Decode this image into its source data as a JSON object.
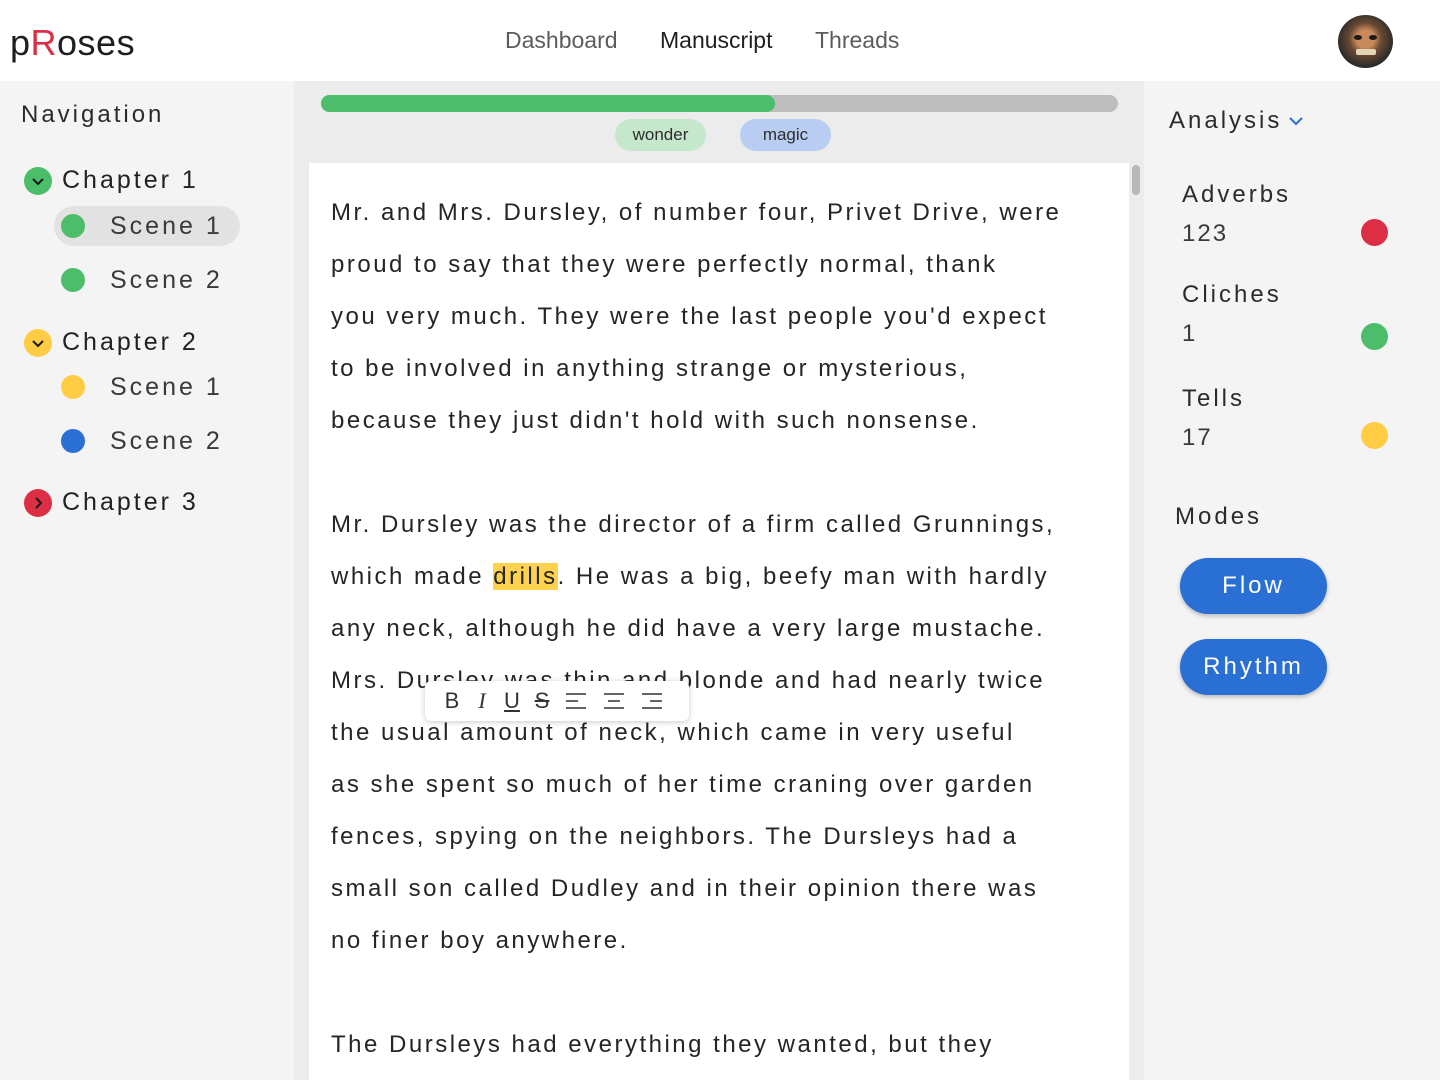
{
  "app": {
    "logo_prefix": "p",
    "logo_accent": "R",
    "logo_suffix": "oses"
  },
  "colors": {
    "brand_red": "#dc2f45",
    "green": "#4cbd6b",
    "yellow": "#ffcc44",
    "blue": "#2a6fd4",
    "red": "#dc2f45"
  },
  "top_nav": {
    "tabs": [
      {
        "label": "Dashboard",
        "active": false
      },
      {
        "label": "Manuscript",
        "active": true
      },
      {
        "label": "Threads",
        "active": false
      }
    ]
  },
  "user": {
    "avatar_icon": "user-avatar"
  },
  "navigation": {
    "title": "Navigation",
    "chapters": [
      {
        "label": "Chapter 1",
        "status": "green",
        "icon": "chevron-down-icon",
        "scenes": [
          {
            "label": "Scene 1",
            "status": "green",
            "active": true
          },
          {
            "label": "Scene 2",
            "status": "green",
            "active": false
          }
        ]
      },
      {
        "label": "Chapter 2",
        "status": "yellow",
        "icon": "chevron-down-icon",
        "scenes": [
          {
            "label": "Scene 1",
            "status": "yellow",
            "active": false
          },
          {
            "label": "Scene 2",
            "status": "blue",
            "active": false
          }
        ]
      },
      {
        "label": "Chapter 3",
        "status": "red",
        "icon": "chevron-right-icon",
        "scenes": []
      }
    ]
  },
  "editor": {
    "progress": 0.57,
    "tags": [
      {
        "label": "wonder",
        "color": "#c5e8cc"
      },
      {
        "label": "magic",
        "color": "#b8cdf1"
      }
    ],
    "paragraph_1": "Mr. and Mrs. Dursley, of number four, Privet Drive, were\nproud to say that they were perfectly normal, thank\nyou very much. They were the last people you'd expect\nto be involved in anything strange or mysterious,\nbecause they just didn't hold with such nonsense.",
    "paragraph_2_before": "Mr. Dursley was the director of a firm called Grunnings,\nwhich made ",
    "paragraph_2_highlight": "drills",
    "paragraph_2_after": ". He was a big, beefy man with hardly\nany neck, although he did have a very large mustache.\nMrs. Dursley was thin and blonde and had nearly twice\nthe usual amount of neck, which came in very useful\nas she spent so much of her time craning over garden\nfences, spying on the neighbors. The Dursleys had a\nsmall son called Dudley and in their opinion there was\nno finer boy anywhere.",
    "paragraph_3": "The Dursleys had everything they wanted, but they",
    "toolbar": {
      "bold": "B",
      "italic": "I",
      "underline": "U",
      "strike": "S"
    }
  },
  "analysis": {
    "title": "Analysis",
    "metrics": [
      {
        "name": "Adverbs",
        "value": "123",
        "status": "red"
      },
      {
        "name": "Cliches",
        "value": "1",
        "status": "green"
      },
      {
        "name": "Tells",
        "value": "17",
        "status": "yellow"
      }
    ],
    "modes_title": "Modes",
    "modes": [
      {
        "label": "Flow"
      },
      {
        "label": "Rhythm"
      }
    ]
  }
}
